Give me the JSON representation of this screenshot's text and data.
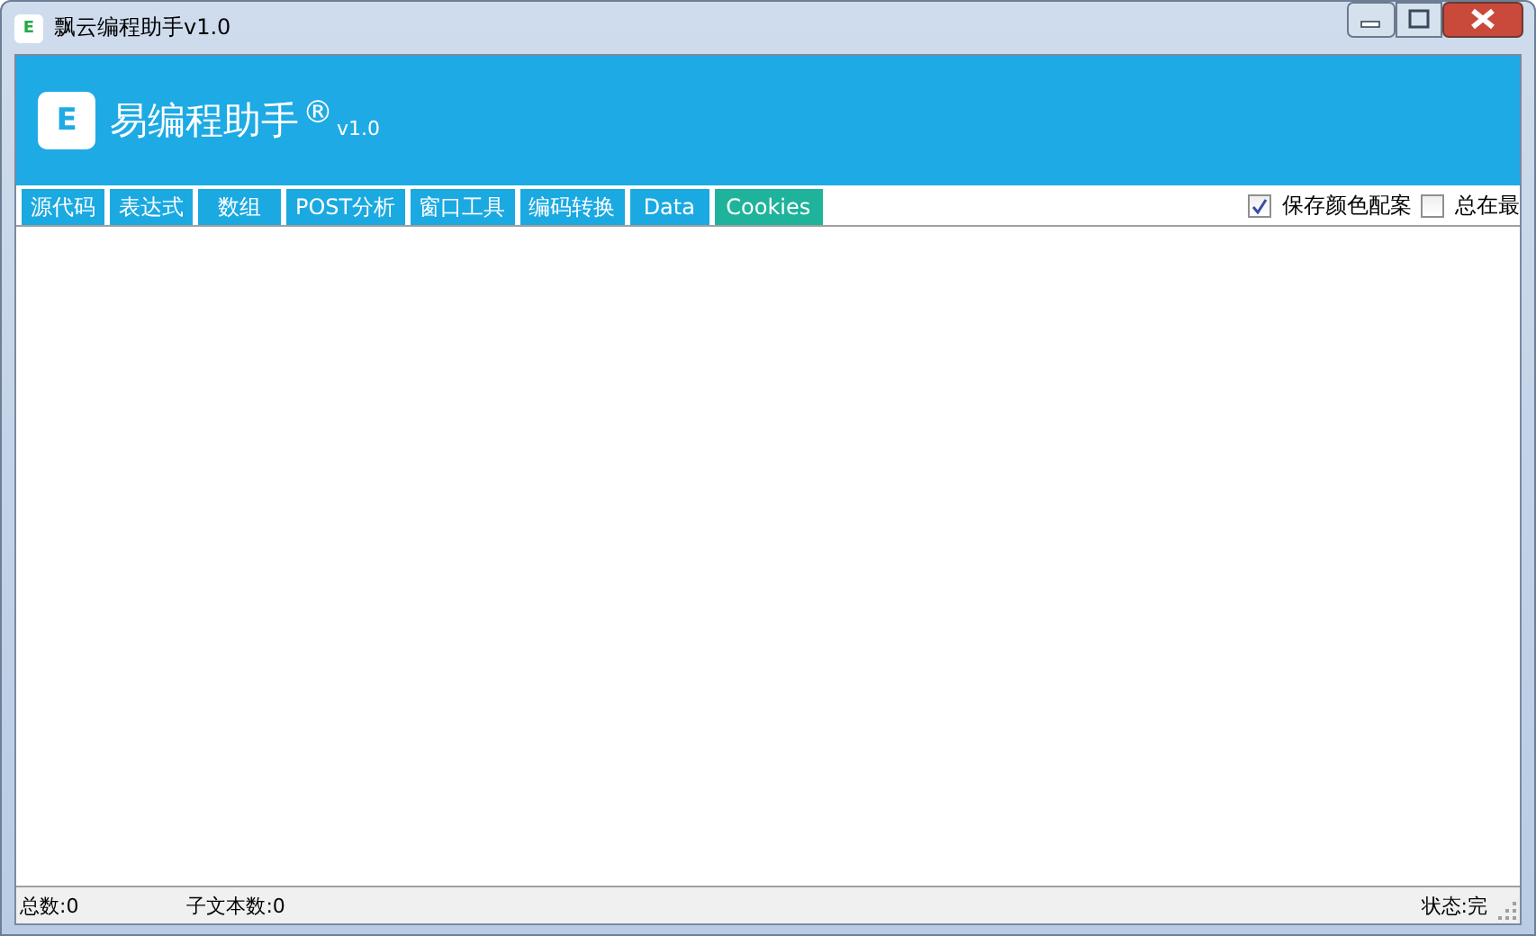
{
  "window": {
    "icon_letter": "E",
    "title": "飘云编程助手v1.0"
  },
  "header": {
    "logo_letter": "E",
    "app_name": "易编程助手",
    "registered": "®",
    "version": "v1.0"
  },
  "tabs": [
    {
      "label": "源代码",
      "selected": false
    },
    {
      "label": "表达式",
      "selected": false
    },
    {
      "label": "数组",
      "selected": false
    },
    {
      "label": "POST分析",
      "selected": false
    },
    {
      "label": "窗口工具",
      "selected": false
    },
    {
      "label": "编码转换",
      "selected": false
    },
    {
      "label": "Data",
      "selected": false
    },
    {
      "label": "Cookies",
      "selected": true
    }
  ],
  "options": [
    {
      "label": "保存颜色配案",
      "checked": true
    },
    {
      "label": "总在最",
      "checked": false
    }
  ],
  "status_bar": {
    "total": "总数:0",
    "sub_count": "子文本数:0",
    "state": "状态:完"
  }
}
